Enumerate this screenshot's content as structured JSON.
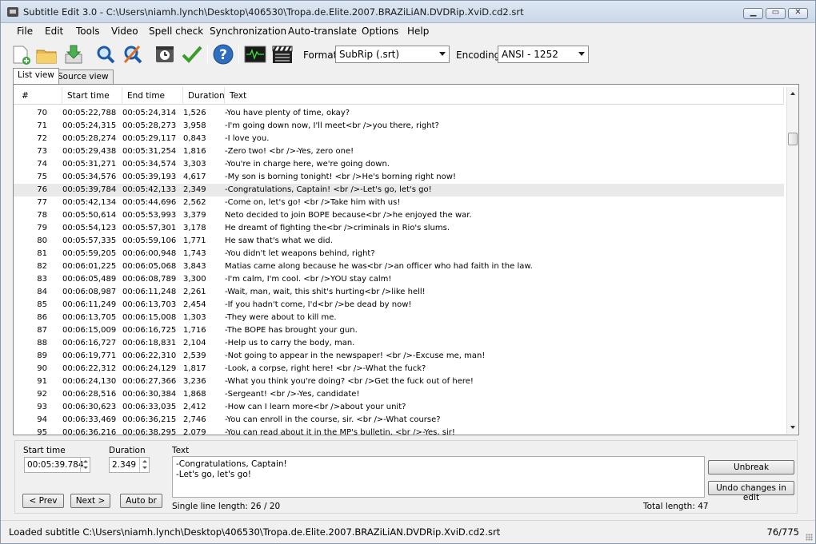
{
  "window": {
    "title": "Subtitle Edit 3.0 - C:\\Users\\niamh.lynch\\Desktop\\406530\\Tropa.de.Elite.2007.BRAZiLiAN.DVDRip.XviD.cd2.srt"
  },
  "menu": [
    "File",
    "Edit",
    "Tools",
    "Video",
    "Spell check",
    "Synchronization",
    "Auto-translate",
    "Options",
    "Help"
  ],
  "toolbar": {
    "icons": [
      "new-file-icon",
      "open-folder-icon",
      "save-download-icon",
      "find-magnifier-icon",
      "replace-magnifier-icon",
      "timing-clock-icon",
      "spellcheck-checkmark-icon",
      "help-question-icon",
      "waveform-icon",
      "video-clapperboard-icon"
    ],
    "format_label": "Format",
    "format_value": "SubRip (.srt)",
    "encoding_label": "Encoding",
    "encoding_value": "ANSI - 1252"
  },
  "tabs": {
    "list_view": "List view",
    "source_view": "Source view"
  },
  "grid": {
    "headers": {
      "num": "#",
      "start": "Start time",
      "end": "End time",
      "duration": "Duration",
      "text": "Text"
    },
    "selected_row": 6,
    "rows": [
      {
        "num": "70",
        "start": "00:05:22,788",
        "end": "00:05:24,314",
        "dur": "1,526",
        "text": "-You have plenty of time, okay?"
      },
      {
        "num": "71",
        "start": "00:05:24,315",
        "end": "00:05:28,273",
        "dur": "3,958",
        "text": "-I'm going down now, I'll meet<br />you there, right?"
      },
      {
        "num": "72",
        "start": "00:05:28,274",
        "end": "00:05:29,117",
        "dur": "0,843",
        "text": "-I love you."
      },
      {
        "num": "73",
        "start": "00:05:29,438",
        "end": "00:05:31,254",
        "dur": "1,816",
        "text": "-Zero two! <br />-Yes, zero one!"
      },
      {
        "num": "74",
        "start": "00:05:31,271",
        "end": "00:05:34,574",
        "dur": "3,303",
        "text": "-You're in charge here, we're going down."
      },
      {
        "num": "75",
        "start": "00:05:34,576",
        "end": "00:05:39,193",
        "dur": "4,617",
        "text": "-My son is borning tonight! <br />He's borning right now!"
      },
      {
        "num": "76",
        "start": "00:05:39,784",
        "end": "00:05:42,133",
        "dur": "2,349",
        "text": "-Congratulations, Captain! <br />-Let's go, let's go!"
      },
      {
        "num": "77",
        "start": "00:05:42,134",
        "end": "00:05:44,696",
        "dur": "2,562",
        "text": "-Come on, let's go! <br />Take him with us!"
      },
      {
        "num": "78",
        "start": "00:05:50,614",
        "end": "00:05:53,993",
        "dur": "3,379",
        "text": "Neto decided to join BOPE because<br />he enjoyed the war."
      },
      {
        "num": "79",
        "start": "00:05:54,123",
        "end": "00:05:57,301",
        "dur": "3,178",
        "text": "He dreamt of fighting the<br />criminals in Rio's slums."
      },
      {
        "num": "80",
        "start": "00:05:57,335",
        "end": "00:05:59,106",
        "dur": "1,771",
        "text": "He saw that's what we did."
      },
      {
        "num": "81",
        "start": "00:05:59,205",
        "end": "00:06:00,948",
        "dur": "1,743",
        "text": "-You didn't let weapons behind, right?"
      },
      {
        "num": "82",
        "start": "00:06:01,225",
        "end": "00:06:05,068",
        "dur": "3,843",
        "text": "Matias came along because he was<br />an officer who had faith in the law."
      },
      {
        "num": "83",
        "start": "00:06:05,489",
        "end": "00:06:08,789",
        "dur": "3,300",
        "text": "-I'm calm, I'm cool. <br />YOU stay calm!"
      },
      {
        "num": "84",
        "start": "00:06:08,987",
        "end": "00:06:11,248",
        "dur": "2,261",
        "text": "-Wait, man, wait, this shit's hurting<br />like hell!"
      },
      {
        "num": "85",
        "start": "00:06:11,249",
        "end": "00:06:13,703",
        "dur": "2,454",
        "text": "-If you hadn't come, I'd<br />be dead by now!"
      },
      {
        "num": "86",
        "start": "00:06:13,705",
        "end": "00:06:15,008",
        "dur": "1,303",
        "text": "-They were about to kill me."
      },
      {
        "num": "87",
        "start": "00:06:15,009",
        "end": "00:06:16,725",
        "dur": "1,716",
        "text": "-The BOPE has brought your gun."
      },
      {
        "num": "88",
        "start": "00:06:16,727",
        "end": "00:06:18,831",
        "dur": "2,104",
        "text": "-Help us to carry the body, man."
      },
      {
        "num": "89",
        "start": "00:06:19,771",
        "end": "00:06:22,310",
        "dur": "2,539",
        "text": "-Not going to appear in the newspaper! <br />-Excuse me, man!"
      },
      {
        "num": "90",
        "start": "00:06:22,312",
        "end": "00:06:24,129",
        "dur": "1,817",
        "text": "-Look, a corpse, right here! <br />-What the fuck?"
      },
      {
        "num": "91",
        "start": "00:06:24,130",
        "end": "00:06:27,366",
        "dur": "3,236",
        "text": "-What you think you're doing? <br />Get the fuck out of here!"
      },
      {
        "num": "92",
        "start": "00:06:28,516",
        "end": "00:06:30,384",
        "dur": "1,868",
        "text": "-Sergeant! <br />-Yes, candidate!"
      },
      {
        "num": "93",
        "start": "00:06:30,623",
        "end": "00:06:33,035",
        "dur": "2,412",
        "text": "-How can I learn more<br />about your unit?"
      },
      {
        "num": "94",
        "start": "00:06:33,469",
        "end": "00:06:36,215",
        "dur": "2,746",
        "text": "-You can enroll in the course, sir. <br />-What course?"
      },
      {
        "num": "95",
        "start": "00:06:36,216",
        "end": "00:06:38,295",
        "dur": "2,079",
        "text": "-You can read about it in the MP's bulletin. <br />-Yes, sir!"
      }
    ]
  },
  "edit": {
    "start_label": "Start time",
    "start_value": "00:05:39.784",
    "duration_label": "Duration",
    "duration_value": "2.349",
    "text_label": "Text",
    "text_line1": "-Congratulations, Captain!",
    "text_line2": "-Let's go, let's go!",
    "prev_button": "< Prev",
    "next_button": "Next >",
    "autobr_button": "Auto br",
    "unbreak_button": "Unbreak",
    "undo_button": "Undo changes in edit",
    "single_line_length": "Single line length: 26 / 20",
    "total_length": "Total length: 47"
  },
  "status": {
    "text": "Loaded subtitle C:\\Users\\niamh.lynch\\Desktop\\406530\\Tropa.de.Elite.2007.BRAZiLiAN.DVDRip.XviD.cd2.srt",
    "count": "76/775"
  }
}
